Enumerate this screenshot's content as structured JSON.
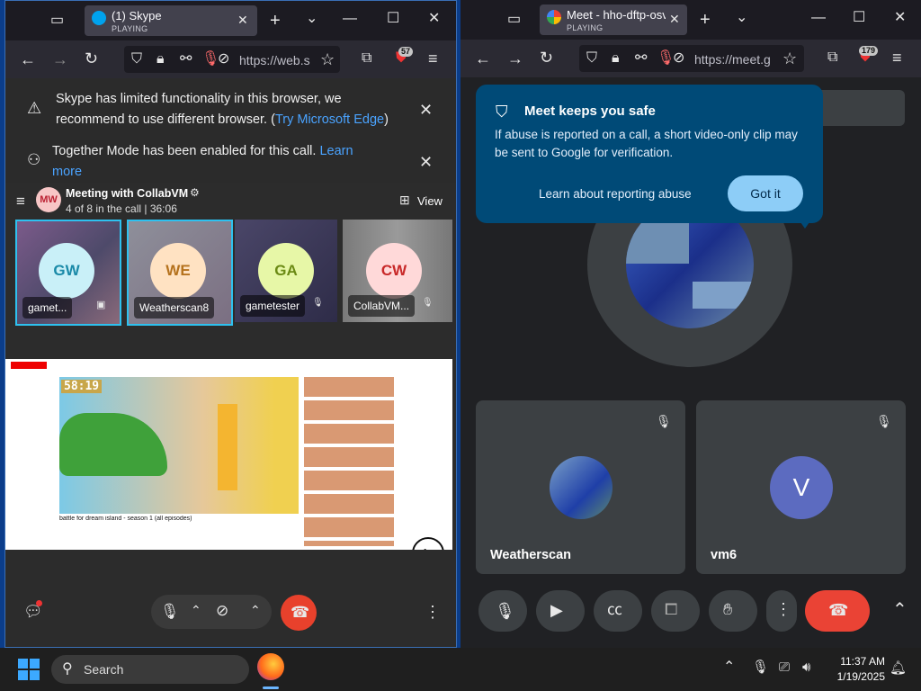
{
  "left": {
    "tab": {
      "title": "(1) Skype",
      "status": "PLAYING"
    },
    "url": "https://web.s",
    "extension_badge": "57",
    "banner1": {
      "text": "Skype has limited functionality in this browser, we recommend to use different browser. (",
      "link": "Try Microsoft Edge",
      "tail": ")"
    },
    "banner2": {
      "text": "Together Mode has been enabled for this call. ",
      "link": "Learn more"
    },
    "meeting": {
      "avatar": "MW",
      "title": "Meeting with CollabVM",
      "subtitle": "4 of 8 in the call | 36:06",
      "view_label": "View"
    },
    "participants": [
      {
        "initials": "GW",
        "name": "gamet..."
      },
      {
        "initials": "WE",
        "name": "Weatherscan8"
      },
      {
        "initials": "GA",
        "name": "gametester"
      },
      {
        "initials": "CW",
        "name": "CollabVM..."
      }
    ],
    "shared": {
      "timer": "58:19",
      "video_title": "battle for dream island - season 1 (all episodes)",
      "zoom": "1x"
    }
  },
  "right": {
    "tab": {
      "title": "Meet - hho-dftp-osv",
      "status": "PLAYING"
    },
    "url": "https://meet.g",
    "extension_badge": "179",
    "popup": {
      "title": "Meet keeps you safe",
      "body": "If abuse is reported on a call, a short video-only clip may be sent to Google for verification.",
      "learn": "Learn about reporting abuse",
      "got_it": "Got it"
    },
    "tiles": [
      {
        "name": "Weatherscan"
      },
      {
        "name": "vm6",
        "initial": "V"
      }
    ]
  },
  "taskbar": {
    "search": "Search",
    "time": "11:37 AM",
    "date": "1/19/2025"
  },
  "colors": {
    "skype_blue": "#00a2ed",
    "meet_popup": "#004a77",
    "end_call": "#ea4335"
  }
}
